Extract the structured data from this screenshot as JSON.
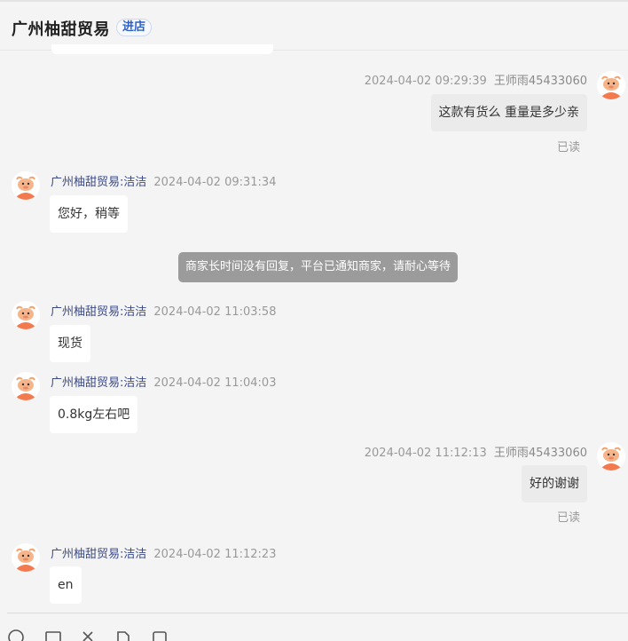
{
  "header": {
    "shop_name": "广州柚甜贸易",
    "enter_label": "进店"
  },
  "messages": [
    {
      "side": "right",
      "time": "2024-04-02 09:29:39",
      "sender": "王师雨45433060",
      "text": "这款有货么 重量是多少亲",
      "status": "已读"
    },
    {
      "side": "left",
      "sender": "广州柚甜贸易:洁洁",
      "time": "2024-04-02 09:31:34",
      "text": "您好，稍等"
    },
    {
      "side": "left",
      "sender": "广州柚甜贸易:洁洁",
      "time": "2024-04-02 11:03:58",
      "text": "现货"
    },
    {
      "side": "left",
      "sender": "广州柚甜贸易:洁洁",
      "time": "2024-04-02 11:04:03",
      "text": "0.8kg左右吧"
    },
    {
      "side": "right",
      "time": "2024-04-02 11:12:13",
      "sender": "王师雨45433060",
      "text": "好的谢谢",
      "status": "已读"
    },
    {
      "side": "left",
      "sender": "广州柚甜贸易:洁洁",
      "time": "2024-04-02 11:12:23",
      "text": "en"
    }
  ],
  "system_notice": "商家长时间没有回复，平台已通知商家，请耐心等待",
  "toolbar": {
    "icons": [
      "emoji-icon",
      "image-icon",
      "scissors-icon",
      "file-icon",
      "order-icon"
    ]
  }
}
